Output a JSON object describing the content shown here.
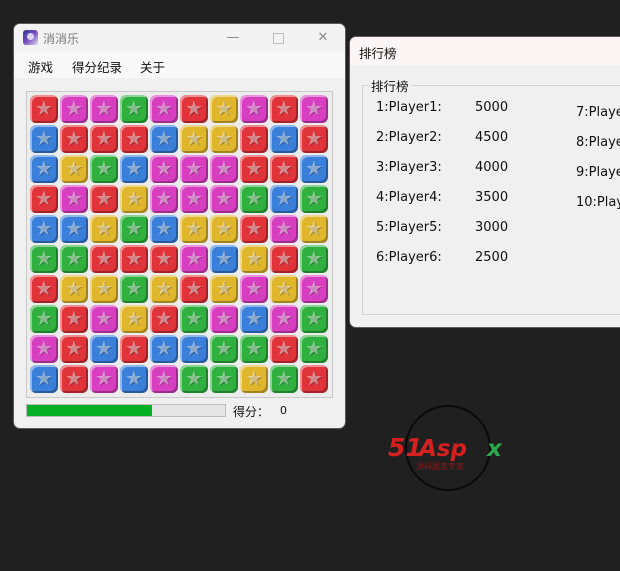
{
  "game_window": {
    "title": "消消乐",
    "controls": {
      "minimize": "—",
      "close": "✕"
    },
    "menu": [
      "游戏",
      "得分纪录",
      "关于"
    ],
    "progress": 0.63,
    "score_label": "得分：",
    "score_value": "0",
    "colors": {
      "R": "#e0333a",
      "M": "#d83fc0",
      "B": "#3a7fd9",
      "G": "#2fb03f",
      "Y": "#e0b62c",
      "progress": "#06b025"
    },
    "grid": [
      "RMMGMRYMRM",
      "BRRRBYYRBR",
      "BYGBMMMRRB",
      "RMRYMMMGBG",
      "BBYGBYYRMY",
      "GGRRRMBYRG",
      "RYYGYRYMYM",
      "GRMYRGMBMG",
      "MRBRBBGGRG",
      "BRMBMGGYGR"
    ]
  },
  "rank_window": {
    "title": "排行榜",
    "group_label": "排行榜",
    "entries": [
      {
        "name": "1:Player1:",
        "score": "5000"
      },
      {
        "name": "2:Player2:",
        "score": "4500"
      },
      {
        "name": "3:Player3:",
        "score": "4000"
      },
      {
        "name": "4:Player4:",
        "score": "3500"
      },
      {
        "name": "5:Player5:",
        "score": "3000"
      },
      {
        "name": "6:Player6:",
        "score": "2500"
      },
      {
        "name": "7:Playe"
      },
      {
        "name": "8:Playe"
      },
      {
        "name": "9:Playe"
      },
      {
        "name": "10:Play"
      }
    ]
  },
  "logo": {
    "brand": "51Aspx",
    "tagline": "源码服务专家",
    "colors": {
      "red": "#d62020",
      "green": "#2ea84a"
    }
  }
}
